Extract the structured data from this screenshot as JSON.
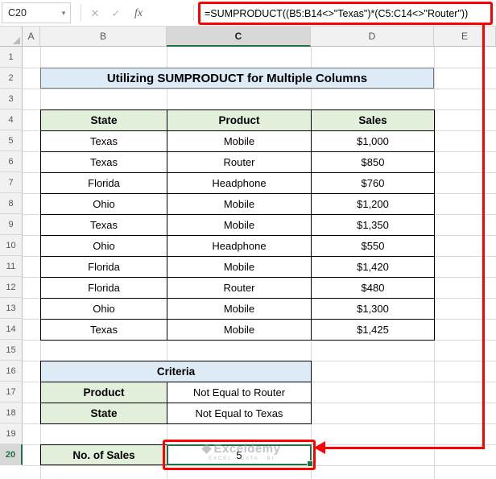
{
  "formula_bar": {
    "name_box": "C20",
    "dropdown_icon": "▾",
    "cancel_icon": "✕",
    "enter_icon": "✓",
    "fx_icon": "fx",
    "formula": "=SUMPRODUCT((B5:B14<>\"Texas\")*(C5:C14<>\"Router\"))"
  },
  "sheet": {
    "col_headers": [
      "A",
      "B",
      "C",
      "D",
      "E"
    ],
    "selected_col": "C",
    "row_count": 20,
    "selected_row": 20
  },
  "title_banner": "Utilizing SUMPRODUCT for Multiple Columns",
  "main_table": {
    "headers": [
      "State",
      "Product",
      "Sales"
    ],
    "rows": [
      [
        "Texas",
        "Mobile",
        "$1,000"
      ],
      [
        "Texas",
        "Router",
        "$850"
      ],
      [
        "Florida",
        "Headphone",
        "$760"
      ],
      [
        "Ohio",
        "Mobile",
        "$1,200"
      ],
      [
        "Texas",
        "Mobile",
        "$1,350"
      ],
      [
        "Ohio",
        "Headphone",
        "$550"
      ],
      [
        "Florida",
        "Mobile",
        "$1,420"
      ],
      [
        "Florida",
        "Router",
        "$480"
      ],
      [
        "Ohio",
        "Mobile",
        "$1,300"
      ],
      [
        "Texas",
        "Mobile",
        "$1,425"
      ]
    ]
  },
  "criteria_table": {
    "title": "Criteria",
    "rows": [
      {
        "label": "Product",
        "value": "Not Equal to Router"
      },
      {
        "label": "State",
        "value": "Not Equal to Texas"
      }
    ]
  },
  "result": {
    "label": "No. of Sales",
    "value": "5"
  },
  "watermark": {
    "brand": "Exceldemy",
    "tagline": "EXCEL · DATA · BI"
  },
  "colors": {
    "accent_green_fill": "#E2EFDA",
    "accent_blue_fill": "#DDEBF7",
    "excel_green": "#1E7145",
    "annotation_red": "#FF0000",
    "watermark_gray": "#9AA0A6"
  }
}
